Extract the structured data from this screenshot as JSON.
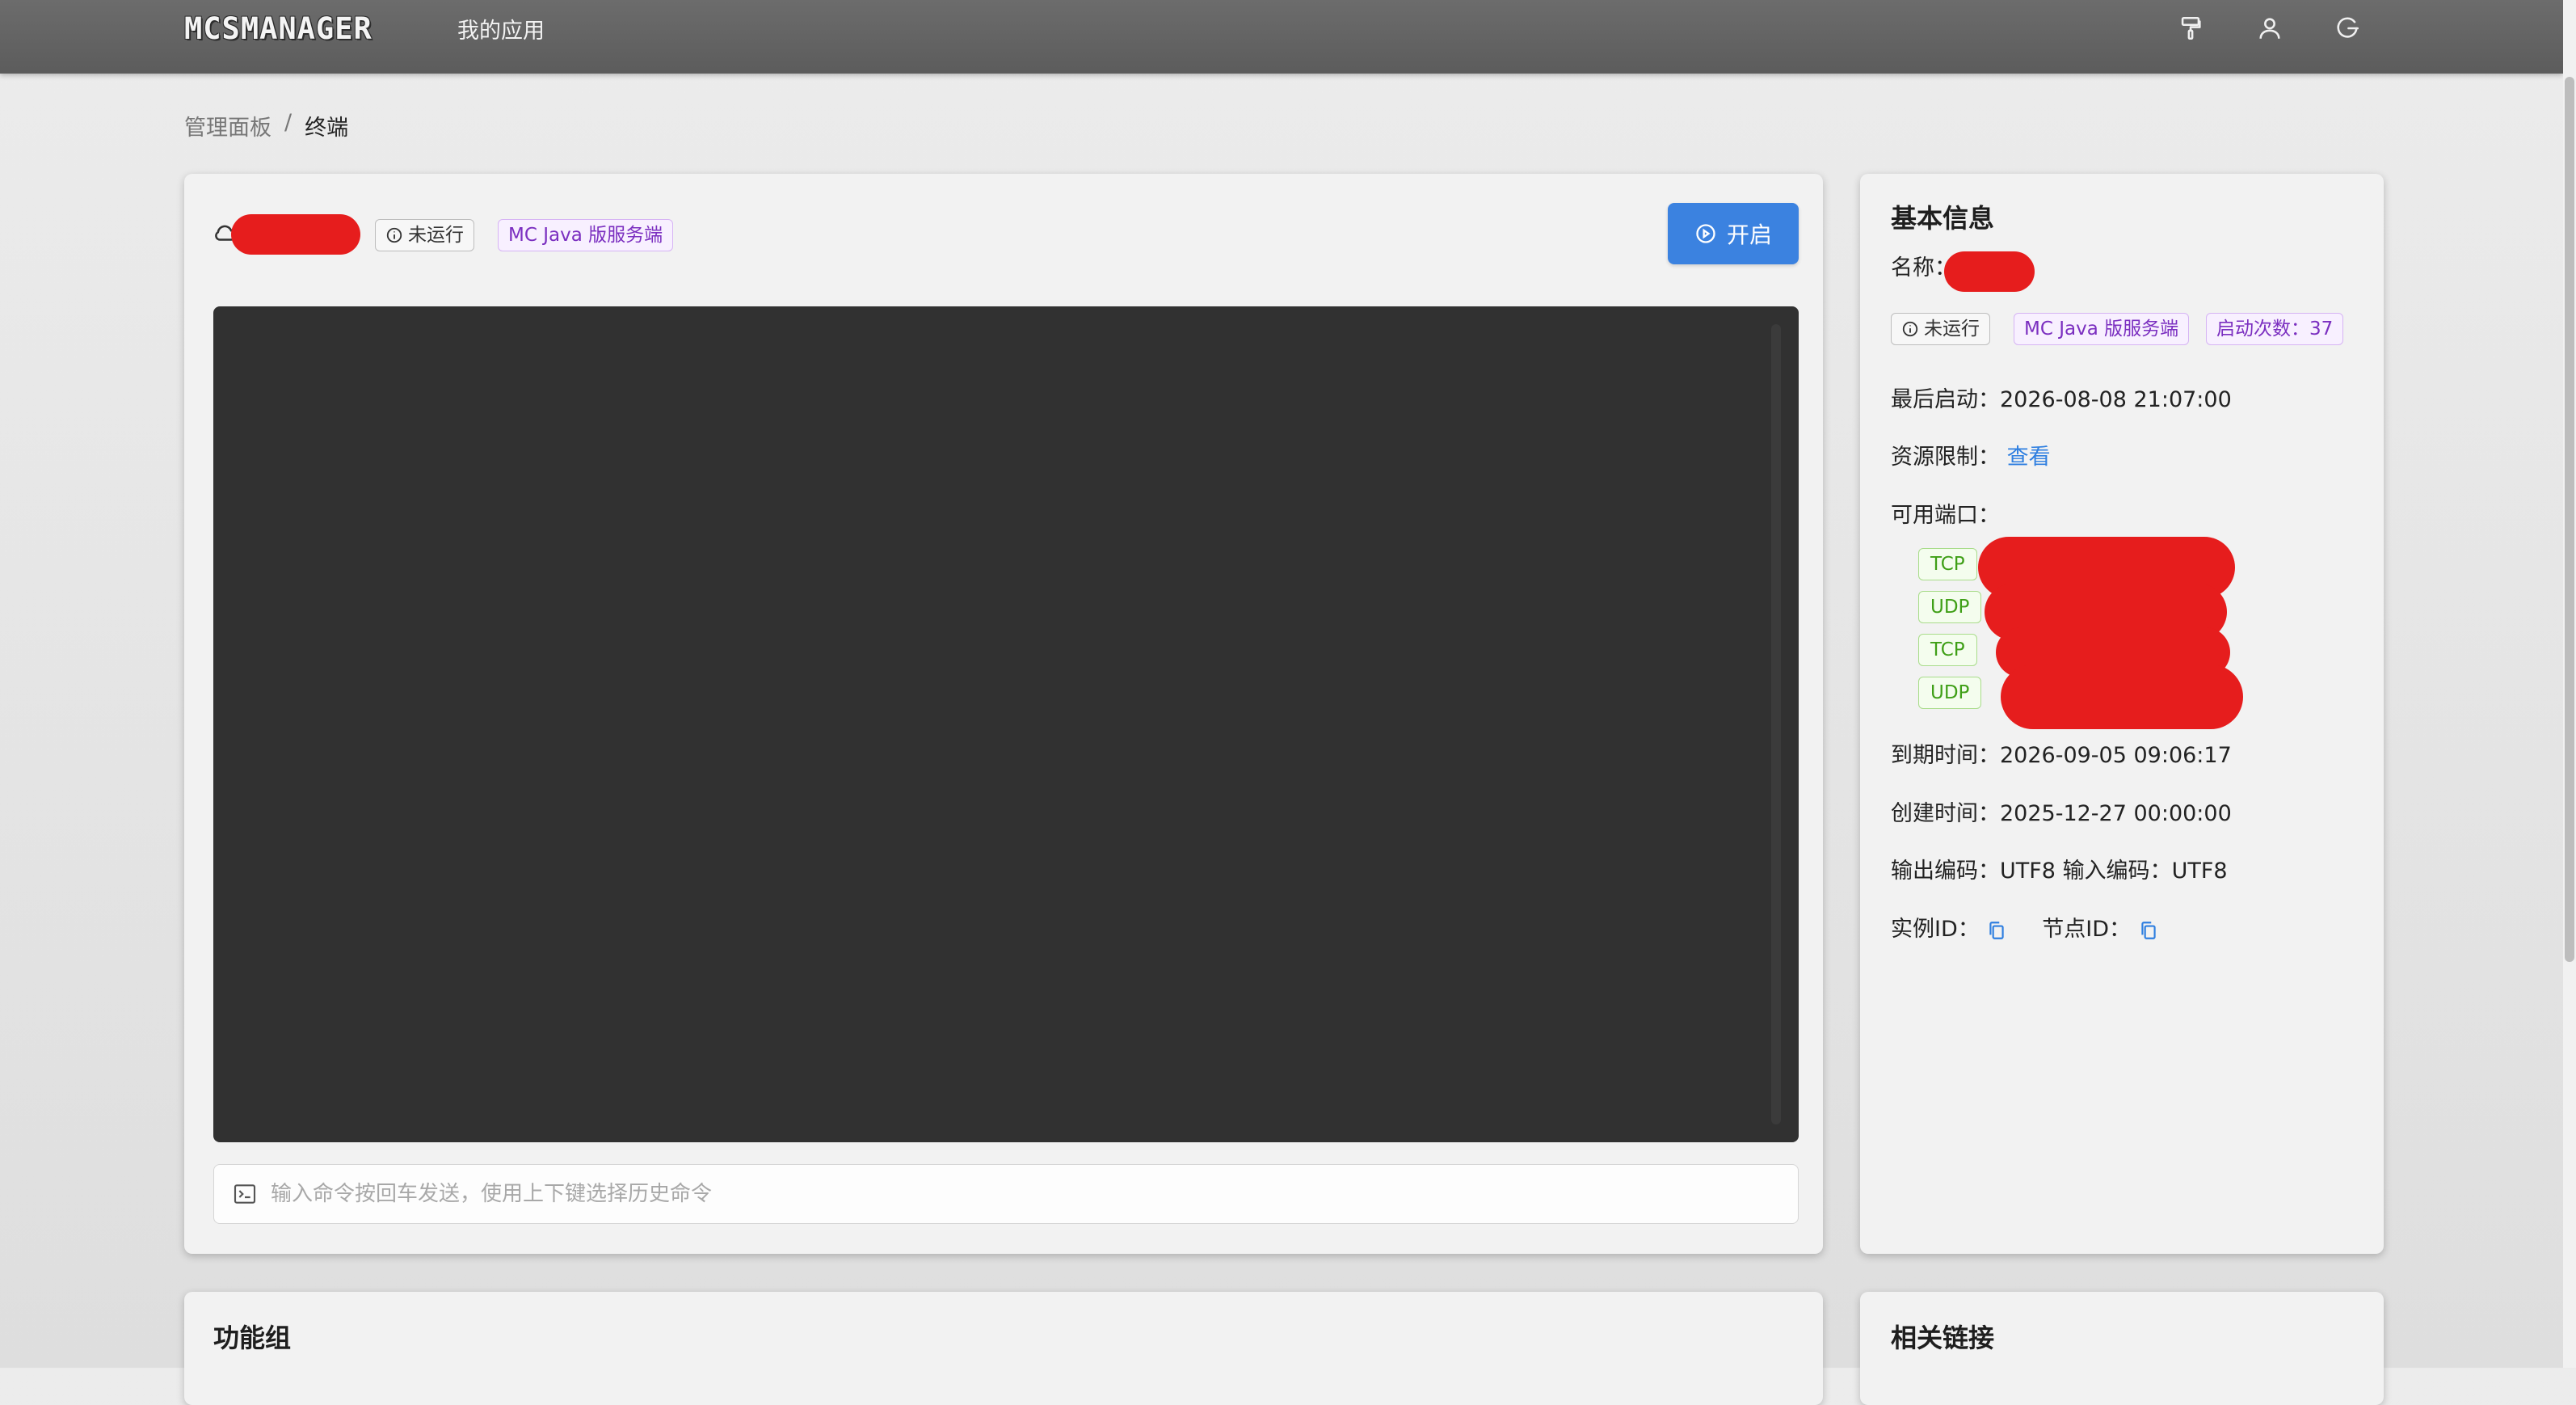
{
  "topbar": {
    "logo": "MCSMANAGER",
    "nav_my_apps": "我的应用",
    "icons": [
      "paint-roller-icon",
      "user-icon",
      "logout-icon"
    ]
  },
  "breadcrumb": {
    "root": "管理面板",
    "separator": "/",
    "current": "终端"
  },
  "main": {
    "status_tag": "未运行",
    "type_tag": "MC Java 版服务端",
    "start_button": "开启",
    "cmd_placeholder": "输入命令按回车发送，使用上下键选择历史命令"
  },
  "info": {
    "title": "基本信息",
    "name_label": "名称：",
    "status_tag": "未运行",
    "type_tag": "MC Java 版服务端",
    "start_count": "启动次数：37",
    "last_start_label": "最后启动：",
    "last_start_value": "2026-08-08 21:07:00",
    "resource_label": "资源限制：",
    "resource_link": "查看",
    "ports_label": "可用端口：",
    "ports": [
      "TCP",
      "UDP",
      "TCP",
      "UDP"
    ],
    "expire_label": "到期时间：",
    "expire_value": "2026-09-05 09:06:17",
    "created_label": "创建时间：",
    "created_value": "2025-12-27 00:00:00",
    "output_enc_label": "输出编码：",
    "output_enc_value": "UTF8",
    "input_enc_label": "输入编码：",
    "input_enc_value": "UTF8",
    "instance_id_label": "实例ID：",
    "node_id_label": "节点ID："
  },
  "func_group": {
    "title": "功能组"
  },
  "links": {
    "title": "相关链接"
  },
  "colors": {
    "primary": "#3b82e0",
    "terminal_bg": "#313131",
    "redaction": "#e61d1d",
    "port_green": "#3f9f17",
    "tag_purple": "#7b2fc0"
  }
}
